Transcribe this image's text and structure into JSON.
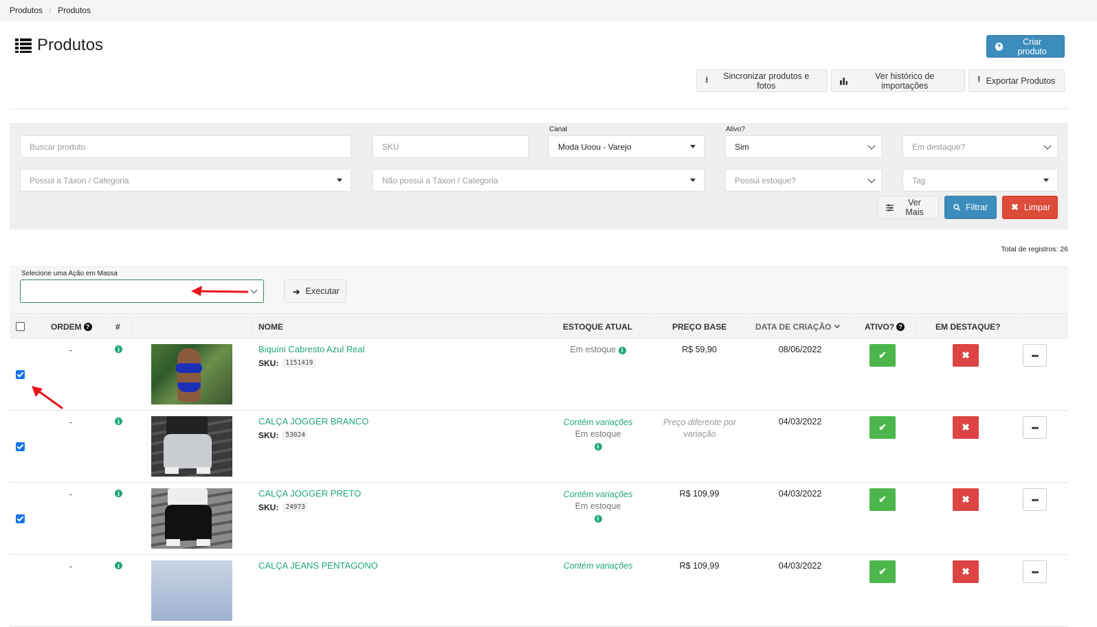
{
  "breadcrumb": [
    "Produtos",
    "Produtos"
  ],
  "title": "Produtos",
  "buttons": {
    "create": "Criar produto",
    "sync": "Sincronizar produtos e fotos",
    "history": "Ver histórico de importações",
    "export": "Exportar Produtos",
    "more": "Ver Mais",
    "filter": "Filtrar",
    "clear": "Limpar",
    "execute": "Executar"
  },
  "filters": {
    "search_placeholder": "Buscar produto",
    "sku_placeholder": "SKU",
    "channel_label": "Canal",
    "channel_value": "Moda Uoou - Varejo",
    "active_label": "Ativo?",
    "active_value": "Sim",
    "featured_placeholder": "Em destaque?",
    "has_taxon_placeholder": "Possui a Táxon / Categoria",
    "no_taxon_placeholder": "Não possui a Táxon / Categoria",
    "stock_placeholder": "Possui estoque?",
    "tag_placeholder": "Tag"
  },
  "total_records": "Total de registros: 26",
  "mass_action_label": "Selecione uma Ação em Massa",
  "table": {
    "headers": {
      "order": "ORDEM",
      "hash": "#",
      "name": "NOME",
      "stock": "ESTOQUE ATUAL",
      "price": "PREÇO BASE",
      "created": "DATA DE CRIAÇÃO",
      "active": "ATIVO?",
      "featured": "EM DESTAQUE?"
    },
    "rows": [
      {
        "order": "-",
        "name": "Biquíni Cabresto Azul Real",
        "sku_label": "SKU:",
        "sku": "1151419",
        "stock_line1": "Em estoque",
        "stock_line2": "",
        "price": "R$ 59,90",
        "price_note": "",
        "date": "08/06/2022",
        "checked": true
      },
      {
        "order": "-",
        "name": "CALÇA JOGGER BRANCO",
        "sku_label": "SKU:",
        "sku": "53024",
        "stock_line1": "Contém variações",
        "stock_line2": "Em estoque",
        "price": "",
        "price_note": "Preço diferente por variação",
        "date": "04/03/2022",
        "checked": true
      },
      {
        "order": "-",
        "name": "CALÇA JOGGER PRETO",
        "sku_label": "SKU:",
        "sku": "24973",
        "stock_line1": "Contém variações",
        "stock_line2": "Em estoque",
        "price": "R$ 109,99",
        "price_note": "",
        "date": "04/03/2022",
        "checked": true
      },
      {
        "order": "-",
        "name": "CALÇA JEANS PENTAGONO",
        "sku_label": "",
        "sku": "",
        "stock_line1": "Contém variações",
        "stock_line2": "",
        "price": "R$ 109,99",
        "price_note": "",
        "date": "04/03/2022",
        "checked": false
      }
    ]
  },
  "colors": {
    "primary": "#3c8dbc",
    "danger": "#dd4b39",
    "success": "#4cb64c",
    "link": "#1fa67a",
    "annotation_arrow": "#e8141b"
  }
}
